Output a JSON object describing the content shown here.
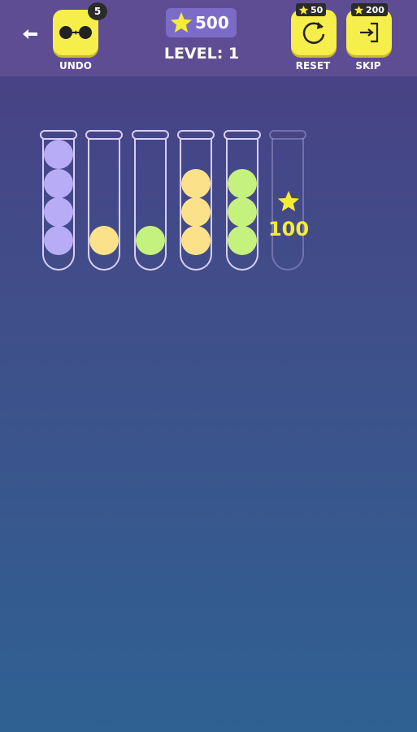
{
  "header": {
    "undo": {
      "label": "UNDO",
      "count": "5"
    },
    "stars": "500",
    "level": "LEVEL: 1",
    "reset": {
      "label": "RESET",
      "cost": "50"
    },
    "skip": {
      "label": "SKIP",
      "cost": "200"
    }
  },
  "board": {
    "tubes": [
      {
        "balls": [
          "purple",
          "purple",
          "purple",
          "purple"
        ]
      },
      {
        "balls": [
          "yellow"
        ]
      },
      {
        "balls": [
          "green"
        ]
      },
      {
        "balls": [
          "yellow",
          "yellow",
          "yellow"
        ]
      },
      {
        "balls": [
          "green",
          "green",
          "green"
        ]
      },
      {
        "balls": [],
        "locked": true,
        "unlock_cost": "100"
      }
    ]
  },
  "colors": {
    "accent_yellow": "#f6ee4b",
    "purple": "#b9acf7",
    "yellow": "#fbe28a",
    "green": "#c5f17e",
    "bonus_text": "#f4ec36"
  }
}
